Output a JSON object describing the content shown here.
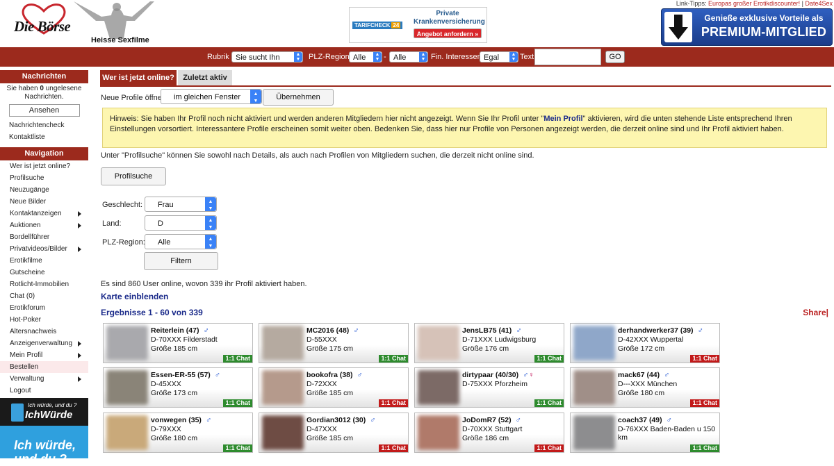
{
  "header": {
    "logo_text": "Die Börse",
    "subtitle": "Heisse Sexfilme",
    "ad": {
      "brand": "TARIFCHECK",
      "brand_num": "24",
      "title": "Private Krankenversicherung",
      "cta": "Angebot anfordern »"
    },
    "link_tips_label": "Link-Tipps:",
    "link_tips_1": "Europas großer Erotikdiscounter!",
    "link_tips_sep": "|",
    "link_tips_2": "Date4Sex",
    "premium_line1": "Genieße exklusive Vorteile als",
    "premium_line2": "PREMIUM-MITGLIED"
  },
  "searchbar": {
    "rubrik_label": "Rubrik",
    "rubrik_value": "Sie sucht Ihn",
    "plz_label": "PLZ-Region",
    "plz_from": "Alle",
    "dash": "-",
    "plz_to": "Alle",
    "fin_label": "Fin. Interessen",
    "fin_value": "Egal",
    "text_label": "Text",
    "text_value": "",
    "go_label": "GO"
  },
  "sidebar": {
    "messages_head": "Nachrichten",
    "messages_text_pre": "Sie haben",
    "messages_count": "0",
    "messages_text_post": "ungelesene Nachrichten.",
    "view_label": "Ansehen",
    "messages_links": [
      "Nachrichtencheck",
      "Kontaktliste"
    ],
    "nav_head": "Navigation",
    "nav_items": [
      {
        "label": "Wer ist jetzt online?",
        "sub": false
      },
      {
        "label": "Profilsuche",
        "sub": false
      },
      {
        "label": "Neuzugänge",
        "sub": false
      },
      {
        "label": "Neue Bilder",
        "sub": false
      },
      {
        "label": "Kontaktanzeigen",
        "sub": true
      },
      {
        "label": "Auktionen",
        "sub": true
      },
      {
        "label": "Bordellführer",
        "sub": false
      },
      {
        "label": "Privatvideos/Bilder",
        "sub": true
      },
      {
        "label": "Erotikfilme",
        "sub": false
      },
      {
        "label": "Gutscheine",
        "sub": false
      },
      {
        "label": "Rotlicht-Immobilien",
        "sub": false
      },
      {
        "label": "Chat (0)",
        "sub": false
      },
      {
        "label": "Erotikforum",
        "sub": false
      },
      {
        "label": "Hot-Poker",
        "sub": false
      },
      {
        "label": "Altersnachweis",
        "sub": false
      },
      {
        "label": "Anzeigenverwaltung",
        "sub": true
      },
      {
        "label": "Mein Profil",
        "sub": true
      },
      {
        "label": "Bestellen",
        "sub": false,
        "active": true
      },
      {
        "label": "Verwaltung",
        "sub": true
      },
      {
        "label": "Logout",
        "sub": false
      }
    ],
    "banner1_small": "Ich würde, und du ?",
    "banner1_big": "IchWürde",
    "banner2_text": "Ich würde, und du ?"
  },
  "main": {
    "tab_active": "Wer ist jetzt online?",
    "tab_inactive": "Zuletzt aktiv",
    "open_label": "Neue Profile öffnen",
    "open_value": "im gleichen Fenster",
    "apply_label": "Übernehmen",
    "hint_text_1": "Hinweis: Sie haben Ihr Profil noch nicht aktiviert und werden anderen Mitgliedern hier nicht angezeigt. Wenn Sie Ihr Profil unter \"",
    "hint_link": "Mein Profil",
    "hint_text_2": "\" aktivieren, wird die unten stehende Liste entsprechend Ihren Einstellungen vorsortiert. Interessantere Profile erscheinen somit weiter oben. Bedenken Sie, dass hier nur Profile von Personen angezeigt werden, die derzeit online sind und Ihr Profil aktiviert haben.",
    "search_info": "Unter \"Profilsuche\" können Sie sowohl nach Details, als auch nach Profilen von Mitgliedern suchen, die derzeit nicht online sind.",
    "profilsuche_label": "Profilsuche",
    "filter": {
      "gender_label": "Geschlecht:",
      "gender_value": "Frau",
      "country_label": "Land:",
      "country_value": "D",
      "plz_label": "PLZ-Region:",
      "plz_value": "Alle",
      "filter_label": "Filtern"
    },
    "online_info": "Es sind 860 User online, wovon 339 ihr Profil aktiviert haben.",
    "map_link": "Karte einblenden",
    "results_label": "Ergebnisse 1 - 60 von 339",
    "share_label": "Share|"
  },
  "profiles": [
    {
      "name": "Reiterlein (47)",
      "gender": "♂",
      "loc": "D-70XXX Filderstadt",
      "size": "Größe 185 cm",
      "chat": "1:1 Chat",
      "chat_color": "green",
      "photo": "#a9a9ad"
    },
    {
      "name": "MC2016 (48)",
      "gender": "♂",
      "loc": "D-55XXX",
      "size": "Größe 175 cm",
      "chat": "1:1 Chat",
      "chat_color": "green",
      "photo": "#b5aaa0"
    },
    {
      "name": "JensLB75 (41)",
      "gender": "♂",
      "loc": "D-71XXX Ludwigsburg",
      "size": "Größe 176 cm",
      "chat": "1:1 Chat",
      "chat_color": "green",
      "photo": "#d6c2b8"
    },
    {
      "name": "derhandwerker37 (39)",
      "gender": "♂",
      "loc": "D-42XXX Wuppertal",
      "size": "Größe 172 cm",
      "chat": "1:1 Chat",
      "chat_color": "red",
      "photo": "#8fa7c9"
    },
    {
      "name": "Essen-ER-55 (57)",
      "gender": "♂",
      "loc": "D-45XXX",
      "size": "Größe 173 cm",
      "chat": "1:1 Chat",
      "chat_color": "green",
      "photo": "#8a8478"
    },
    {
      "name": "bookofra (38)",
      "gender": "♂",
      "loc": "D-72XXX",
      "size": "Größe 185 cm",
      "chat": "1:1 Chat",
      "chat_color": "red",
      "photo": "#b59a8c"
    },
    {
      "name": "dirtypaar (40/30)",
      "gender": "♂♀",
      "loc": "D-75XXX Pforzheim",
      "size": "",
      "chat": "1:1 Chat",
      "chat_color": "green",
      "photo": "#7c6a66"
    },
    {
      "name": "mack67 (44)",
      "gender": "♂",
      "loc": "D---XXX München",
      "size": "Größe 180 cm",
      "chat": "1:1 Chat",
      "chat_color": "red",
      "photo": "#a08f88"
    },
    {
      "name": "vonwegen (35)",
      "gender": "♂",
      "loc": "D-79XXX",
      "size": "Größe 180 cm",
      "chat": "1:1 Chat",
      "chat_color": "green",
      "photo": "#c9a97a"
    },
    {
      "name": "Gordian3012 (30)",
      "gender": "♂",
      "loc": "D-47XXX",
      "size": "Größe 185 cm",
      "chat": "1:1 Chat",
      "chat_color": "red",
      "photo": "#6e4c44"
    },
    {
      "name": "JoDomR7 (52)",
      "gender": "♂",
      "loc": "D-70XXX Stuttgart",
      "size": "Größe 186 cm",
      "chat": "1:1 Chat",
      "chat_color": "red",
      "photo": "#b07a6a"
    },
    {
      "name": "coach37 (49)",
      "gender": "♂",
      "loc": "D-76XXX Baden-Baden u 150 km",
      "size": "",
      "chat": "1:1 Chat",
      "chat_color": "green",
      "photo": "#8d8d8f"
    }
  ],
  "colors": {
    "brand_red": "#9c2a1d",
    "link_blue": "#1a2a8a",
    "male_blue": "#1a4fd0",
    "female_red": "#c2185b",
    "hint_bg": "#fdf6b0"
  }
}
